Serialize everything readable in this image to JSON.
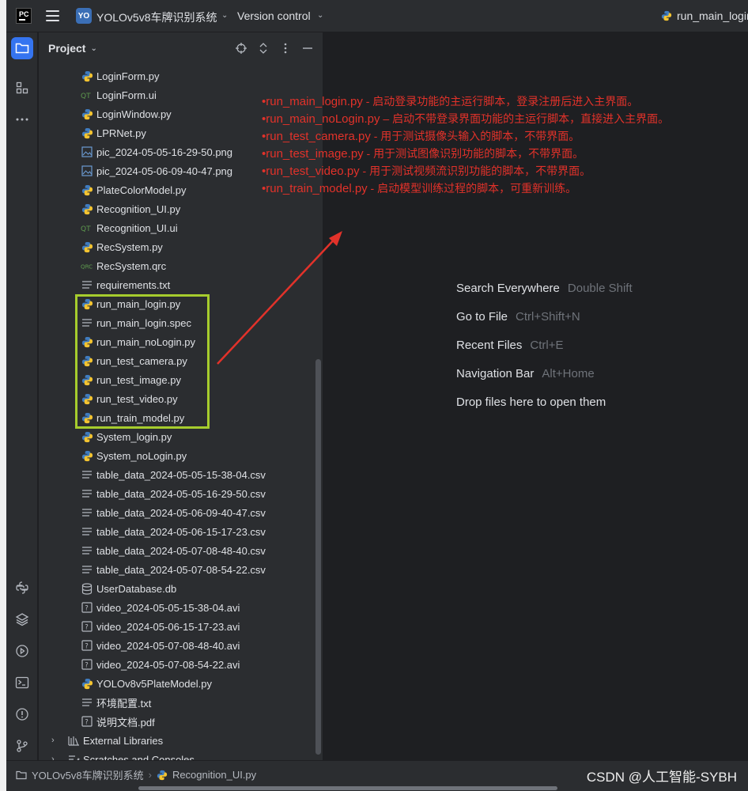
{
  "titlebar": {
    "project_badge": "YO",
    "project_name": "YOLOv5v8车牌识别系统",
    "version_control": "Version control",
    "run_config": "run_main_login"
  },
  "panel": {
    "title": "Project"
  },
  "tree": [
    {
      "name": "LoginForm.py",
      "icon": "python-file-icon"
    },
    {
      "name": "LoginForm.ui",
      "icon": "qt-ui-file-icon"
    },
    {
      "name": "LoginWindow.py",
      "icon": "python-file-icon"
    },
    {
      "name": "LPRNet.py",
      "icon": "python-file-icon"
    },
    {
      "name": "pic_2024-05-05-16-29-50.png",
      "icon": "image-file-icon"
    },
    {
      "name": "pic_2024-05-06-09-40-47.png",
      "icon": "image-file-icon"
    },
    {
      "name": "PlateColorModel.py",
      "icon": "python-file-icon"
    },
    {
      "name": "Recognition_UI.py",
      "icon": "python-file-icon"
    },
    {
      "name": "Recognition_UI.ui",
      "icon": "qt-ui-file-icon"
    },
    {
      "name": "RecSystem.py",
      "icon": "python-file-icon"
    },
    {
      "name": "RecSystem.qrc",
      "icon": "qrc-file-icon"
    },
    {
      "name": "requirements.txt",
      "icon": "text-file-icon"
    },
    {
      "name": "run_main_login.py",
      "icon": "python-file-icon"
    },
    {
      "name": "run_main_login.spec",
      "icon": "text-file-icon"
    },
    {
      "name": "run_main_noLogin.py",
      "icon": "python-file-icon"
    },
    {
      "name": "run_test_camera.py",
      "icon": "python-file-icon"
    },
    {
      "name": "run_test_image.py",
      "icon": "python-file-icon"
    },
    {
      "name": "run_test_video.py",
      "icon": "python-file-icon"
    },
    {
      "name": "run_train_model.py",
      "icon": "python-file-icon"
    },
    {
      "name": "System_login.py",
      "icon": "python-file-icon"
    },
    {
      "name": "System_noLogin.py",
      "icon": "python-file-icon"
    },
    {
      "name": "table_data_2024-05-05-15-38-04.csv",
      "icon": "text-file-icon"
    },
    {
      "name": "table_data_2024-05-05-16-29-50.csv",
      "icon": "text-file-icon"
    },
    {
      "name": "table_data_2024-05-06-09-40-47.csv",
      "icon": "text-file-icon"
    },
    {
      "name": "table_data_2024-05-06-15-17-23.csv",
      "icon": "text-file-icon"
    },
    {
      "name": "table_data_2024-05-07-08-48-40.csv",
      "icon": "text-file-icon"
    },
    {
      "name": "table_data_2024-05-07-08-54-22.csv",
      "icon": "text-file-icon"
    },
    {
      "name": "UserDatabase.db",
      "icon": "database-file-icon"
    },
    {
      "name": "video_2024-05-05-15-38-04.avi",
      "icon": "unknown-file-icon"
    },
    {
      "name": "video_2024-05-06-15-17-23.avi",
      "icon": "unknown-file-icon"
    },
    {
      "name": "video_2024-05-07-08-48-40.avi",
      "icon": "unknown-file-icon"
    },
    {
      "name": "video_2024-05-07-08-54-22.avi",
      "icon": "unknown-file-icon"
    },
    {
      "name": "YOLOv8v5PlateModel.py",
      "icon": "python-file-icon"
    },
    {
      "name": "环境配置.txt",
      "icon": "text-file-icon"
    },
    {
      "name": "说明文档.pdf",
      "icon": "unknown-file-icon"
    }
  ],
  "tree_groups": [
    {
      "name": "External Libraries",
      "icon": "library-icon"
    },
    {
      "name": "Scratches and Consoles",
      "icon": "scratches-icon"
    }
  ],
  "notes": [
    {
      "file": "•run_main_login.py",
      "desc": " - 启动登录功能的主运行脚本，登录注册后进入主界面。"
    },
    {
      "file": "•run_main_noLogin.py",
      "desc": " – 启动不带登录界面功能的主运行脚本，直接进入主界面。"
    },
    {
      "file": "•run_test_camera.py",
      "desc": " - 用于测试摄像头输入的脚本，不带界面。"
    },
    {
      "file": "•run_test_image.py",
      "desc": " - 用于测试图像识别功能的脚本，不带界面。"
    },
    {
      "file": "•run_test_video.py",
      "desc": " - 用于测试视频流识别功能的脚本，不带界面。"
    },
    {
      "file": "•run_train_model.py",
      "desc": " - 启动模型训练过程的脚本，可重新训练。"
    }
  ],
  "hints": [
    {
      "action": "Search Everywhere",
      "shortcut": "Double Shift"
    },
    {
      "action": "Go to File",
      "shortcut": "Ctrl+Shift+N"
    },
    {
      "action": "Recent Files",
      "shortcut": "Ctrl+E"
    },
    {
      "action": "Navigation Bar",
      "shortcut": "Alt+Home"
    },
    {
      "action": "Drop files here to open them",
      "shortcut": ""
    }
  ],
  "statusbar": {
    "crumb_project": "YOLOv5v8车牌识别系统",
    "crumb_file": "Recognition_UI.py",
    "watermark": "CSDN @人工智能-SYBH"
  },
  "colors": {
    "annotation_red": "#e2322a",
    "highlight_green": "#a6cc2d",
    "accent_blue": "#3574f0"
  }
}
